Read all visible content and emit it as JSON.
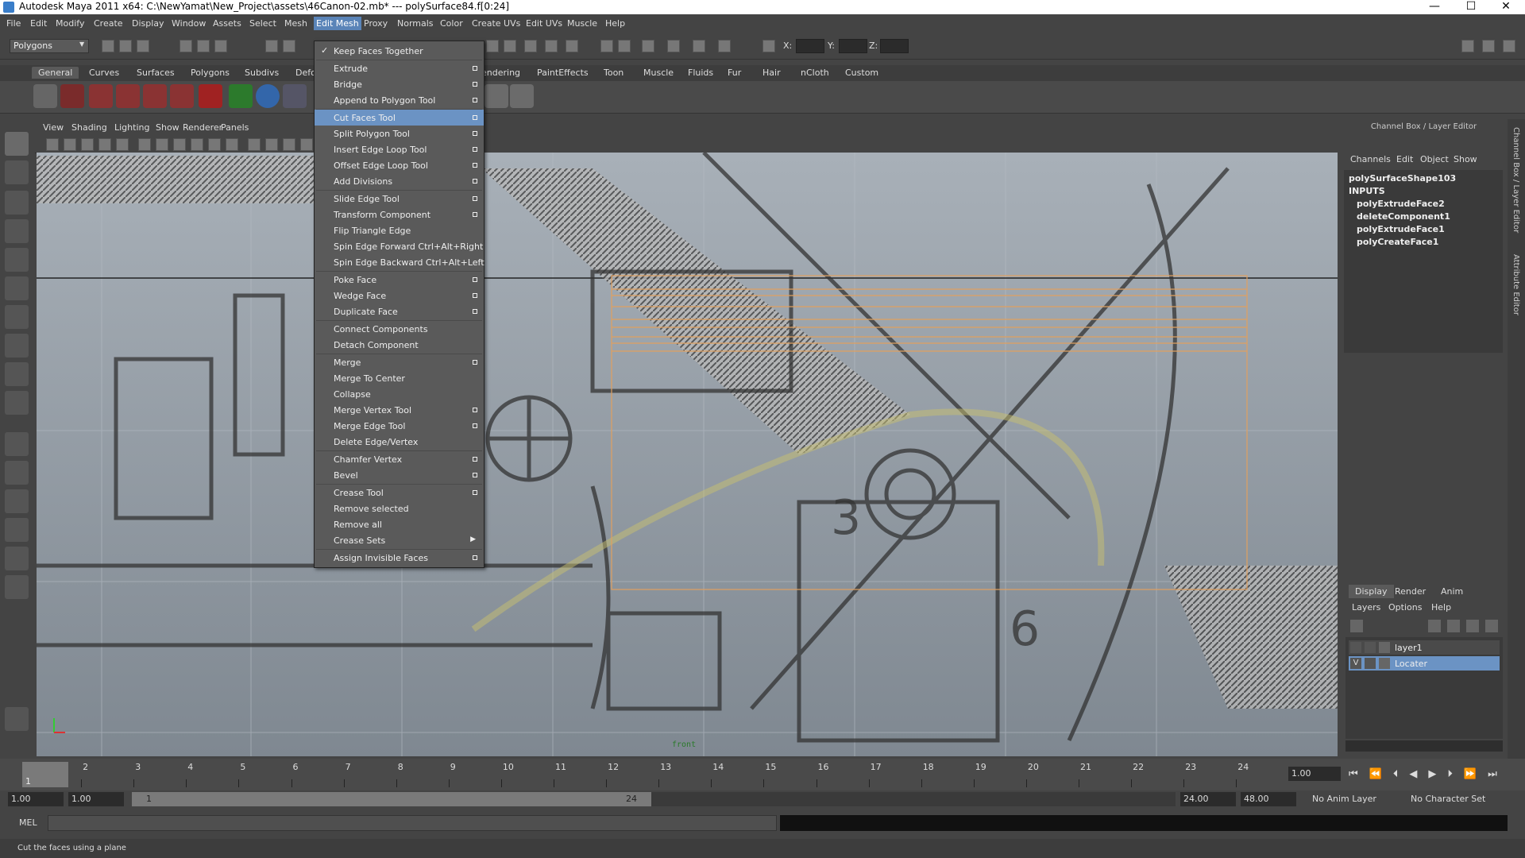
{
  "title": "Autodesk Maya 2011 x64: C:\\NewYamat\\New_Project\\assets\\46Canon-02.mb*  ---  polySurface84.f[0:24]",
  "menubar": [
    "File",
    "Edit",
    "Modify",
    "Create",
    "Display",
    "Window",
    "Assets",
    "Select",
    "Mesh",
    "Edit Mesh",
    "Proxy",
    "Normals",
    "Color",
    "Create UVs",
    "Edit UVs",
    "Muscle",
    "Help"
  ],
  "toolbar": {
    "mode": "Polygons",
    "x_label": "X:",
    "y_label": "Y:",
    "z_label": "Z:"
  },
  "shelf_tabs": [
    "General",
    "Curves",
    "Surfaces",
    "Polygons",
    "Subdivs",
    "Defo",
    "endering",
    "PaintEffects",
    "Toon",
    "Muscle",
    "Fluids",
    "Fur",
    "Hair",
    "nCloth",
    "Custom"
  ],
  "viewport": {
    "menus": [
      "View",
      "Shading",
      "Lighting",
      "Show",
      "Renderer",
      "Panels"
    ],
    "camera_label": "front"
  },
  "edit_mesh_menu": [
    {
      "label": "Keep Faces Together",
      "checked": true,
      "opt": false
    },
    {
      "sep": true
    },
    {
      "label": "Extrude",
      "opt": true
    },
    {
      "label": "Bridge",
      "opt": true
    },
    {
      "label": "Append to Polygon Tool",
      "opt": true
    },
    {
      "sep": true
    },
    {
      "label": "Cut Faces Tool",
      "opt": true,
      "highlight": true
    },
    {
      "label": "Split Polygon Tool",
      "opt": true
    },
    {
      "label": "Insert Edge Loop Tool",
      "opt": true
    },
    {
      "label": "Offset Edge Loop Tool",
      "opt": true
    },
    {
      "label": "Add Divisions",
      "opt": true
    },
    {
      "sep": true
    },
    {
      "label": "Slide Edge Tool",
      "opt": true
    },
    {
      "label": "Transform Component",
      "opt": true
    },
    {
      "label": "Flip Triangle Edge"
    },
    {
      "label": "Spin Edge Forward  Ctrl+Alt+Right"
    },
    {
      "label": "Spin Edge Backward  Ctrl+Alt+Left"
    },
    {
      "sep": true
    },
    {
      "label": "Poke Face",
      "opt": true
    },
    {
      "label": "Wedge Face",
      "opt": true
    },
    {
      "label": "Duplicate Face",
      "opt": true
    },
    {
      "sep": true
    },
    {
      "label": "Connect Components"
    },
    {
      "label": "Detach Component"
    },
    {
      "sep": true
    },
    {
      "label": "Merge",
      "opt": true
    },
    {
      "label": "Merge To Center"
    },
    {
      "label": "Collapse"
    },
    {
      "label": "Merge Vertex Tool",
      "opt": true
    },
    {
      "label": "Merge Edge Tool",
      "opt": true
    },
    {
      "label": "Delete Edge/Vertex"
    },
    {
      "sep": true
    },
    {
      "label": "Chamfer Vertex",
      "opt": true
    },
    {
      "label": "Bevel",
      "opt": true
    },
    {
      "sep": true
    },
    {
      "label": "Crease Tool",
      "opt": true
    },
    {
      "label": "Remove selected"
    },
    {
      "label": "Remove all"
    },
    {
      "label": "Crease Sets",
      "submenu": true
    },
    {
      "sep": true
    },
    {
      "label": "Assign Invisible Faces",
      "opt": true
    }
  ],
  "channel_box": {
    "header": "Channel Box / Layer Editor",
    "tabs": [
      "Channels",
      "Edit",
      "Object",
      "Show"
    ],
    "shape": "polySurfaceShape103",
    "inputs_label": "INPUTS",
    "inputs": [
      "polyExtrudeFace2",
      "deleteComponent1",
      "polyExtrudeFace1",
      "polyCreateFace1"
    ]
  },
  "side_tabs": [
    "Channel Box / Layer Editor",
    "Attribute Editor"
  ],
  "layer_editor": {
    "tabs": [
      "Display",
      "Render",
      "Anim"
    ],
    "menus": [
      "Layers",
      "Options",
      "Help"
    ],
    "layers": [
      {
        "name": "layer1",
        "v": "",
        "selected": false
      },
      {
        "name": "Locater",
        "v": "V",
        "selected": true
      }
    ]
  },
  "timeline": {
    "ticks": [
      "1",
      "2",
      "3",
      "4",
      "5",
      "6",
      "7",
      "8",
      "9",
      "10",
      "11",
      "12",
      "13",
      "14",
      "15",
      "16",
      "17",
      "18",
      "19",
      "20",
      "21",
      "22",
      "23",
      "24"
    ],
    "current_frame": "1",
    "current_value": "1.00"
  },
  "range": {
    "start": "1.00",
    "start2": "1.00",
    "slider_start": "1",
    "slider_end": "24",
    "end": "24.00",
    "end2": "48.00",
    "anim_layer": "No Anim Layer",
    "char_set": "No Character Set"
  },
  "mel_label": "MEL",
  "status": "Cut the faces using a plane",
  "colors": {
    "accent": "#6b93c4",
    "menubar_active": "#5a84b8",
    "bg": "#444444"
  }
}
